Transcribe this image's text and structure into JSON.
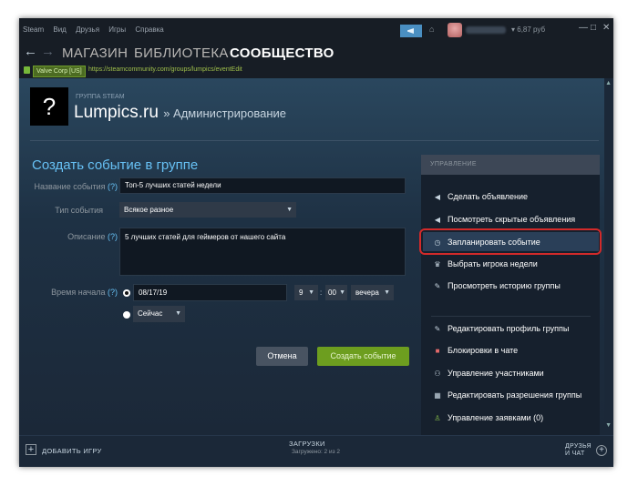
{
  "menu": [
    "Steam",
    "Вид",
    "Друзья",
    "Игры",
    "Справка"
  ],
  "account": {
    "balance": "6,87 руб"
  },
  "window_buttons": {
    "minimize": "—",
    "restore": "□",
    "close": "✕"
  },
  "nav": {
    "back": "←",
    "forward": "→",
    "store": "МАГАЗИН",
    "library": "БИБЛИОТЕКА",
    "community": "СООБЩЕСТВО"
  },
  "address": {
    "cert": "Valve Corp [US]",
    "url": "https://steamcommunity.com/groups/lumpics/eventEdit"
  },
  "group": {
    "icon": "?",
    "type_label": "ГРУППА STEAM",
    "name": "Lumpics.ru",
    "crumb": "» Администрирование"
  },
  "form": {
    "title": "Создать событие в группе",
    "q": "(?)",
    "name_label": "Название события",
    "name_value": "Топ-5 лучших статей недели",
    "type_label": "Тип события",
    "type_value": "Всякое разное",
    "desc_label": "Описание",
    "desc_value": "5 лучших статей для геймеров от нашего сайта",
    "time_label": "Время начала",
    "date_value": "08/17/19",
    "hour": "9",
    "minute": "00",
    "ampm": "вечера",
    "now_value": "Сейчас",
    "cancel": "Отмена",
    "create": "Создать событие"
  },
  "side": {
    "header": "УПРАВЛЕНИЕ",
    "items": [
      {
        "icon": "megaphone-icon",
        "label": "Сделать объявление"
      },
      {
        "icon": "megaphone-icon",
        "label": "Посмотреть скрытые объявления"
      },
      {
        "icon": "clock-icon",
        "label": "Запланировать событие"
      },
      {
        "icon": "trophy-icon",
        "label": "Выбрать игрока недели"
      },
      {
        "icon": "history-icon",
        "label": "Просмотреть историю группы"
      },
      {
        "icon": "pencil-icon",
        "label": "Редактировать профиль группы"
      },
      {
        "icon": "block-icon",
        "label": "Блокировки в чате"
      },
      {
        "icon": "members-icon",
        "label": "Управление участниками"
      },
      {
        "icon": "grid-icon",
        "label": "Редактировать разрешения группы"
      },
      {
        "icon": "requests-icon",
        "label": "Управление заявками (0)"
      }
    ]
  },
  "bottom": {
    "add_game": "ДОБАВИТЬ ИГРУ",
    "downloads": "ЗАГРУЗКИ",
    "downloads_status": "Загружено: 2 из 2",
    "friends_line1": "ДРУЗЬЯ",
    "friends_line2": "И ЧАТ"
  }
}
